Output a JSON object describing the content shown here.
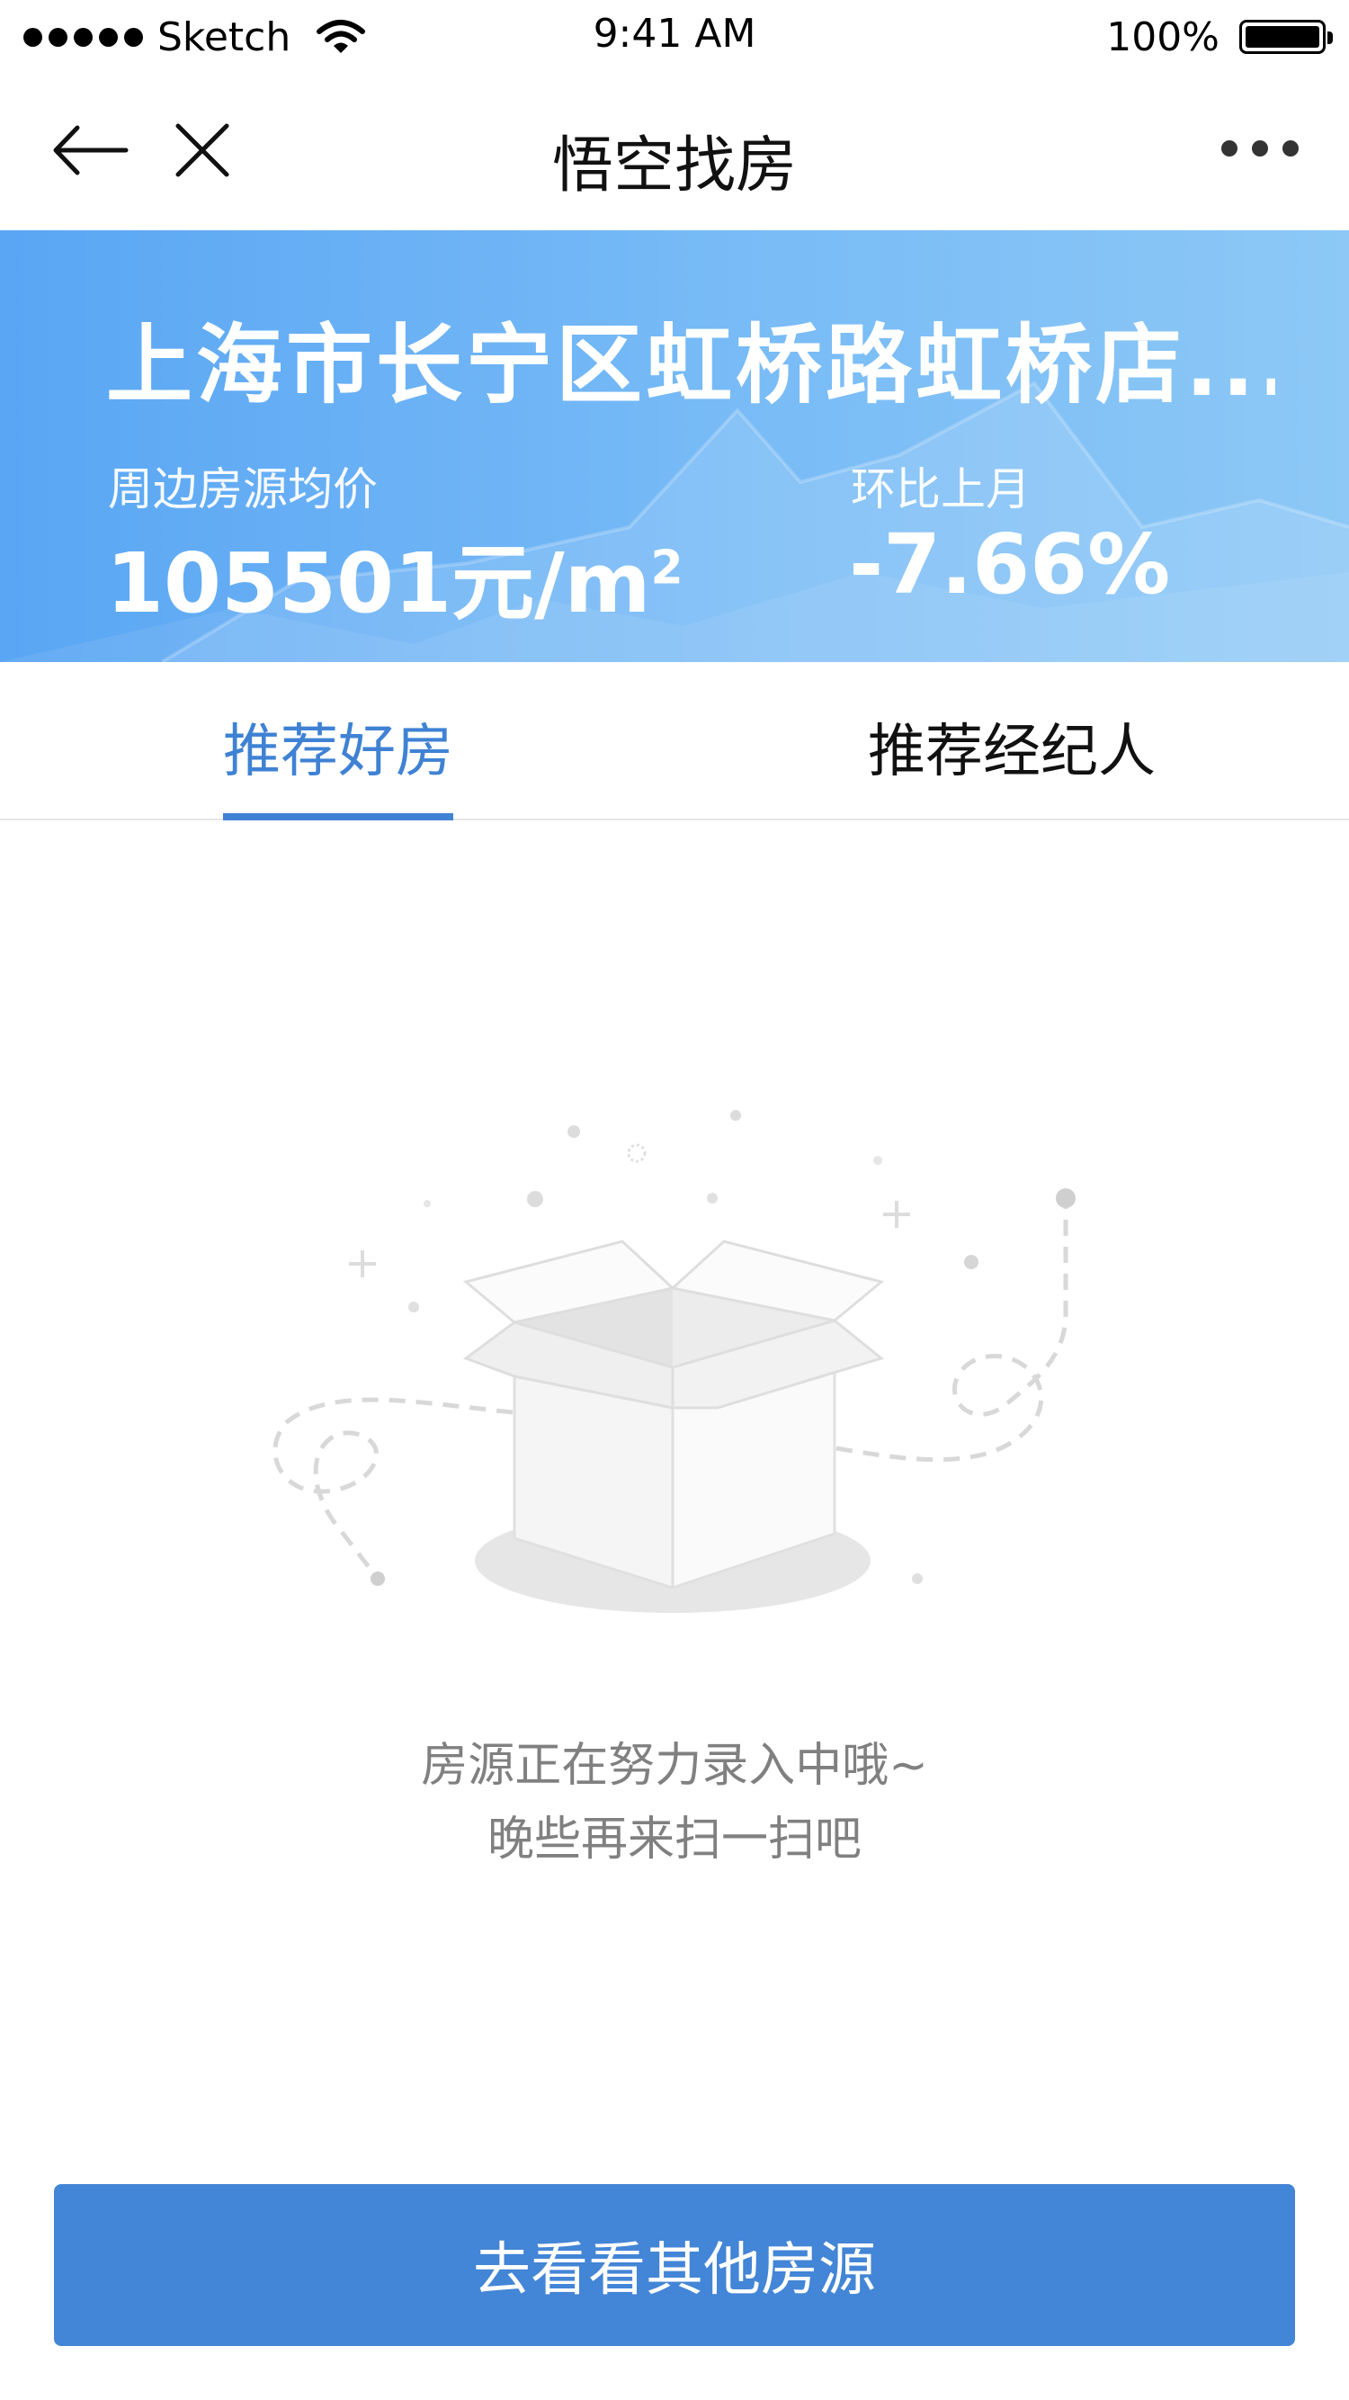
{
  "status_bar": {
    "carrier": "Sketch",
    "time": "9:41 AM",
    "battery": "100%"
  },
  "nav": {
    "title": "悟空找房",
    "back_icon": "arrow-left-icon",
    "close_icon": "close-icon",
    "more_icon": "more-dots-icon"
  },
  "banner": {
    "title": "上海市长宁区虹桥路虹桥店...",
    "avg_price_label": "周边房源均价",
    "avg_price_value": "105501元/m",
    "avg_price_unit_sup": "2",
    "mom_label": "环比上月",
    "mom_value": "-7.66%"
  },
  "tabs": [
    {
      "label": "推荐好房",
      "active": true
    },
    {
      "label": "推荐经纪人",
      "active": false
    }
  ],
  "empty_state": {
    "illustration": "empty-box-icon",
    "line1": "房源正在努力录入中哦~",
    "line2": "晚些再来扫一扫吧"
  },
  "action_button": {
    "label": "去看看其他房源"
  },
  "colors": {
    "accent": "#3f82d4",
    "button": "#4385d6",
    "banner_start": "#5aa6f4",
    "banner_end": "#8dc8f6"
  }
}
